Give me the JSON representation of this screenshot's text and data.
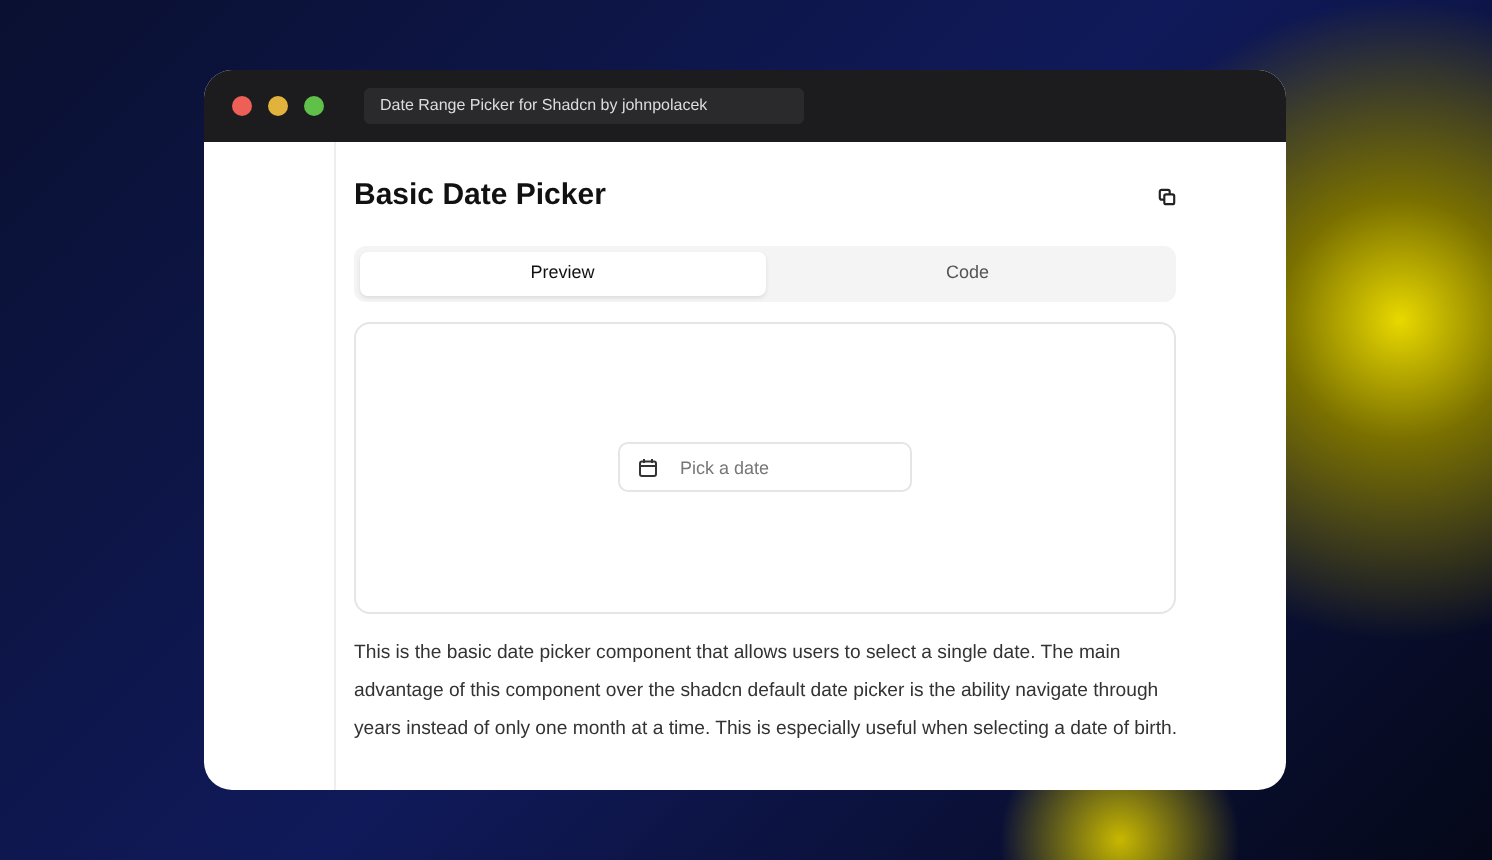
{
  "window": {
    "title": "Date Range Picker for Shadcn by johnpolacek"
  },
  "page": {
    "heading": "Basic Date Picker",
    "tabs": [
      {
        "label": "Preview",
        "selected": true
      },
      {
        "label": "Code",
        "selected": false
      }
    ],
    "date_field": {
      "placeholder": "Pick a date"
    },
    "description": "This is the basic date picker component that allows users to select a single date. The main advantage of this component over the shadcn default date picker is the ability navigate through years instead of only one month at a time. This is especially useful when selecting a date of birth."
  }
}
